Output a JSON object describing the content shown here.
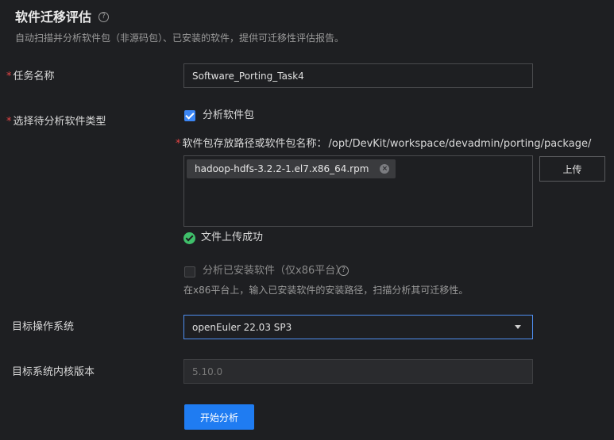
{
  "header": {
    "title": "软件迁移评估",
    "subtitle": "自动扫描并分析软件包（非源码包）、已安装的软件，提供可迁移性评估报告。",
    "help_glyph": "?"
  },
  "form": {
    "required_mark": "*",
    "task_name": {
      "label": "任务名称",
      "value": "Software_Porting_Task4"
    },
    "software_type": {
      "label": "选择待分析软件类型",
      "analyze_package": {
        "label": "分析软件包",
        "checked": true
      },
      "package_path": {
        "label": "软件包存放路径或软件包名称：",
        "path": "/opt/DevKit/workspace/devadmin/porting/package/"
      },
      "uploaded_file": {
        "name": "hadoop-hdfs-3.2.2-1.el7.x86_64.rpm",
        "remove_glyph": "×"
      },
      "upload_button": "上传",
      "upload_status": "文件上传成功",
      "analyze_installed": {
        "label": "分析已安装软件（仅x86平台）",
        "checked": false,
        "help_glyph": "?"
      },
      "installed_hint": "在x86平台上，输入已安装软件的安装路径，扫描分析其可迁移性。"
    },
    "target_os": {
      "label": "目标操作系统",
      "selected": "openEuler 22.03 SP3"
    },
    "target_kernel": {
      "label": "目标系统内核版本",
      "value": "5.10.0"
    },
    "start_button": "开始分析"
  },
  "colors": {
    "background": "#1e1f22",
    "primary": "#1f7cf2",
    "success": "#3fbf6a",
    "required": "#e54545"
  }
}
